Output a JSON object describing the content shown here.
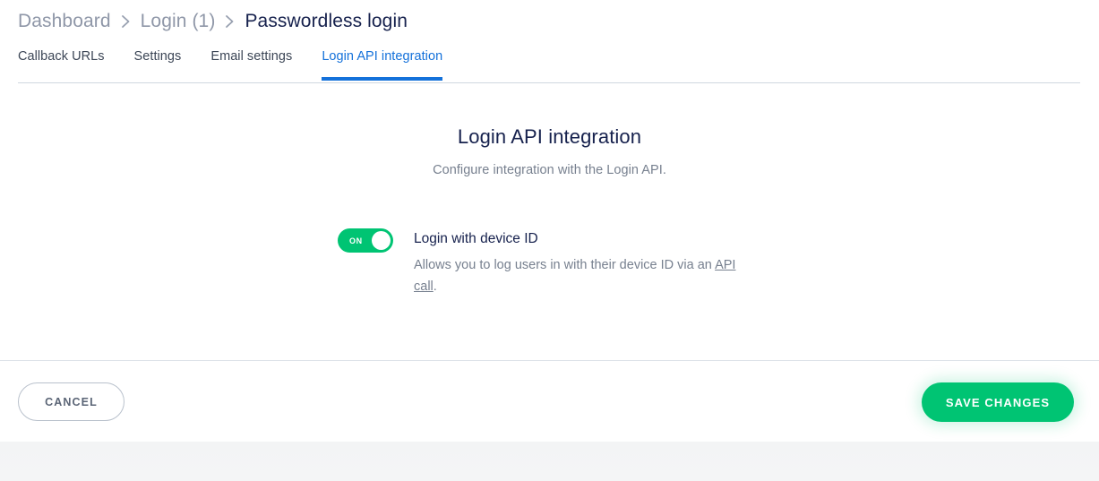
{
  "breadcrumb": {
    "items": [
      {
        "label": "Dashboard",
        "current": false
      },
      {
        "label": "Login (1)",
        "current": false
      },
      {
        "label": "Passwordless login",
        "current": true
      }
    ],
    "separator_icon": "chevron-right-icon"
  },
  "tabs": [
    {
      "label": "Callback URLs",
      "active": false
    },
    {
      "label": "Settings",
      "active": false
    },
    {
      "label": "Email settings",
      "active": false
    },
    {
      "label": "Login API integration",
      "active": true
    }
  ],
  "main": {
    "title": "Login API integration",
    "subtitle": "Configure integration with the Login API."
  },
  "setting": {
    "toggle_state": "ON",
    "toggle_on": true,
    "name": "Login with device ID",
    "description_before": "Allows you to log users in with their device ID via an ",
    "description_link": "API call",
    "description_after": "."
  },
  "footer": {
    "cancel_label": "CANCEL",
    "save_label": "SAVE CHANGES"
  },
  "colors": {
    "accent_green": "#00C473",
    "accent_blue": "#1471DA",
    "heading_navy": "#16214D",
    "muted_gray": "#77808F"
  }
}
